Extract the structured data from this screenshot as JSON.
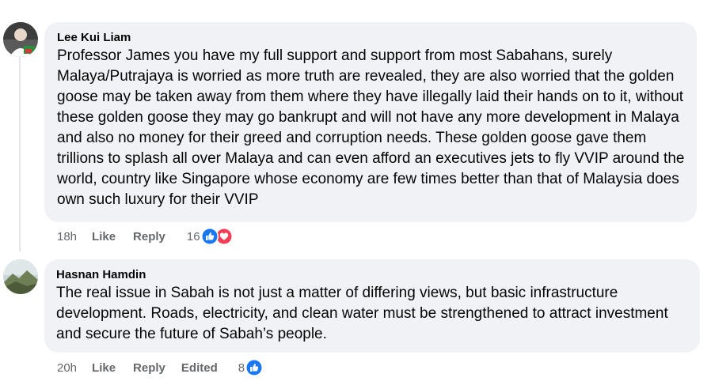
{
  "comments": [
    {
      "author": "Lee Kui Liam",
      "text": "Professor James you have my full support and support from most Sabahans, surely Malaya/Putrajaya is worried as more truth are revealed, they are also worried that the golden goose may be taken away from them where they have illegally laid their hands on to it, without these golden goose they may go bankrupt and will not have any more development in Malaya and also no money for their greed and corruption needs. These golden goose gave them trillions to splash all over Malaya and can even afford an executives jets to fly VVIP around the world, country like Singapore whose economy are few times better than that of Malaysia does own such luxury for their VVIP",
      "time": "18h",
      "like_label": "Like",
      "reply_label": "Reply",
      "reaction_count": "16"
    },
    {
      "author": "Hasnan Hamdin",
      "text": "The real issue in Sabah is not just a matter of differing views, but basic infrastructure development. Roads, electricity, and clean water must be strengthened to attract investment and secure the future of Sabah’s people.",
      "time": "20h",
      "like_label": "Like",
      "reply_label": "Reply",
      "edited_label": "Edited",
      "reaction_count": "8"
    }
  ],
  "colors": {
    "bubble": "#f0f2f5",
    "meta_text": "#65676b",
    "like_blue": "#1877f2",
    "love_red": "#f33e58"
  },
  "icons": {
    "like": "thumbs-up-icon",
    "love": "heart-icon"
  }
}
